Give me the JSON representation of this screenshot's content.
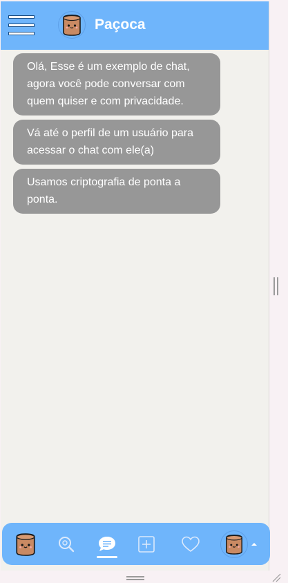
{
  "header": {
    "title": "Paçoca",
    "menu_icon": "hamburger-menu-icon",
    "logo_icon": "pacoca-mascot-icon"
  },
  "messages": [
    {
      "text": "Olá, Esse é um exemplo de chat, agora você pode conversar com quem quiser e com privacidade."
    },
    {
      "text": "Vá até o perfil de um usuário para acessar o chat com ele(a)"
    },
    {
      "text": "Usamos criptografia de ponta a ponta."
    }
  ],
  "bottom_nav": {
    "items": [
      {
        "name": "home",
        "icon": "pacoca-mascot-icon"
      },
      {
        "name": "search",
        "icon": "search-icon"
      },
      {
        "name": "chat",
        "icon": "chat-bubble-icon",
        "active": true
      },
      {
        "name": "create",
        "icon": "add-square-icon"
      },
      {
        "name": "favorites",
        "icon": "heart-icon"
      },
      {
        "name": "profile",
        "icon": "avatar-icon",
        "has_dropdown": true
      }
    ]
  },
  "colors": {
    "brand_blue": "#6fb5fb",
    "message_bubble": "#979797",
    "chat_background": "#f2f1ed",
    "mascot_body": "#c98a63"
  }
}
